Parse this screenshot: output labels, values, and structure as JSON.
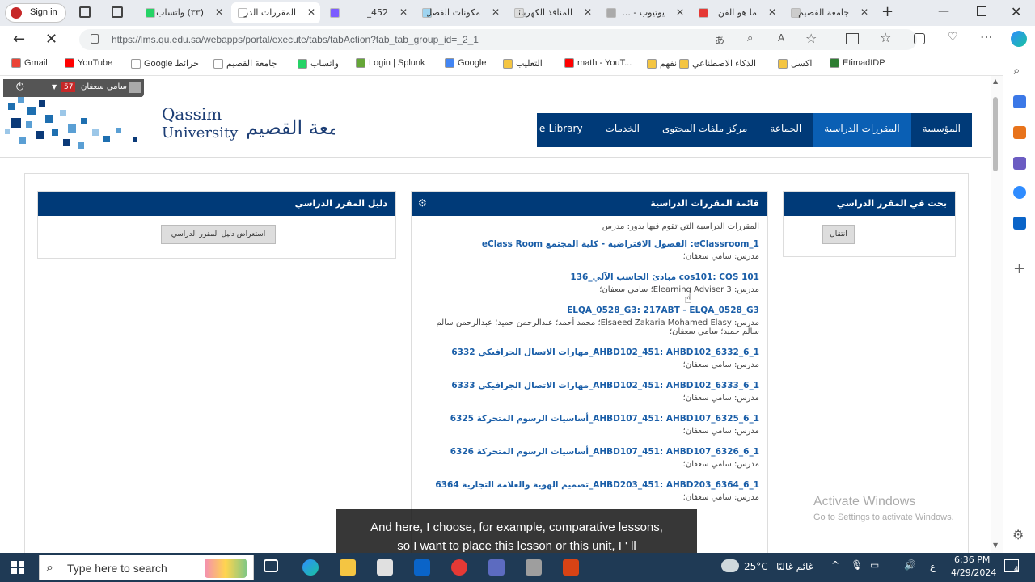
{
  "browser": {
    "profile_label": "Sign in",
    "tabs": [
      {
        "title": "(٣٣) واتساب",
        "fav_color": "#25d366"
      },
      {
        "title": "المقررات الدراسية",
        "fav_color": "#ffffff",
        "active": true
      },
      {
        "title": "452_",
        "fav_color": "#7b5cff"
      },
      {
        "title": "مكونات الفصل",
        "fav_color": "#9fd4f0"
      },
      {
        "title": "المنافذ الكهربائية",
        "fav_color": "#dddddd"
      },
      {
        "title": "يوتيوب - ...",
        "fav_color": "#aaaaaa"
      },
      {
        "title": "ما هو الفن",
        "fav_color": "#e53935"
      },
      {
        "title": "جامعة القصيم",
        "fav_color": "#cccccc"
      }
    ],
    "url": "https://lms.qu.edu.sa/webapps/portal/execute/tabs/tabAction?tab_tab_group_id=_2_1",
    "bookmarks": [
      {
        "label": "Gmail",
        "color": "#ea4335"
      },
      {
        "label": "YouTube",
        "color": "#ff0000"
      },
      {
        "label": "Google خرائط",
        "color": "#ffffff"
      },
      {
        "label": "جامعة القصيم",
        "color": "#ffffff"
      },
      {
        "label": "واتساب",
        "color": "#25d366"
      },
      {
        "label": "Login | Splunk",
        "color": "#65a637"
      },
      {
        "label": "Google",
        "color": "#4285f4"
      },
      {
        "label": "التعليب",
        "color": "#f4c542"
      },
      {
        "label": "math - YouT...",
        "color": "#ff0000"
      },
      {
        "label": "يلا نفهم",
        "color": "#f4c542"
      },
      {
        "label": "الذكاء الاصطناعي",
        "color": "#f4c542"
      },
      {
        "label": "اكسل",
        "color": "#f4c542"
      },
      {
        "label": "EtimadIDP",
        "color": "#2e7d32"
      }
    ]
  },
  "site": {
    "user_name": "سامي سعفان",
    "notification_count": "57",
    "logo_en": "Qassim University",
    "logo_ar": "جامعة القصيم",
    "nav": [
      {
        "label": "المؤسسة"
      },
      {
        "label": "المقررات الدراسية",
        "active": true
      },
      {
        "label": "الجماعة"
      },
      {
        "label": "مركز ملفات المحتوى"
      },
      {
        "label": "الخدمات"
      },
      {
        "label": "e-Library"
      }
    ]
  },
  "modules": {
    "search": {
      "title": "بحث في المقرر الدراسي",
      "button": "انتقال"
    },
    "courses": {
      "title": "قائمة المقررات الدراسية",
      "intro": "المقررات الدراسية التي تقوم فيها بدور: مدرس",
      "items": [
        {
          "title": "eClassroom_1: الفصول الافتراضية - كلية المجتمع eClass Room",
          "meta": "مدرس: سامي سعفان؛"
        },
        {
          "title": "cos101: COS 101 مبادئ الحاسب الآلي_136",
          "meta": "مدرس: Elearning Adviser 3؛ سامي سعفان؛"
        },
        {
          "title": "ELQA_0528_G3: 217ABT - ELQA_0528_G3",
          "meta": "مدرس: Elsaeed Zakaria Mohamed Elasy؛ محمد أحمد؛ عبدالرحمن حميد؛ عبدالرحمن سالم سالم حميد؛ سامي سعفان؛"
        },
        {
          "title": "1_6_AHBD102_451: AHBD102_6332_مهارات الاتصال الجرافيكي 6332",
          "meta": "مدرس: سامي سعفان؛"
        },
        {
          "title": "1_6_AHBD102_451: AHBD102_6333_مهارات الاتصال الجرافيكي 6333",
          "meta": "مدرس: سامي سعفان؛"
        },
        {
          "title": "1_6_AHBD107_451: AHBD107_6325_أساسيات الرسوم المتحركة 6325",
          "meta": "مدرس: سامي سعفان؛"
        },
        {
          "title": "1_6_AHBD107_451: AHBD107_6326_أساسيات الرسوم المتحركة 6326",
          "meta": "مدرس: سامي سعفان؛"
        },
        {
          "title": "1_6_AHBD203_451: AHBD203_6364_تصميم الهوية والعلامة التجارية 6364",
          "meta": "مدرس: سامي سعفان؛"
        }
      ]
    },
    "guide": {
      "title": "دليل المقرر الدراسي",
      "button": "استعراض دليل المقرر الدراسي"
    }
  },
  "watermark": {
    "line1": "Activate Windows",
    "line2": "Go to Settings to activate Windows."
  },
  "subtitles": {
    "line1": "And here, I choose, for example, comparative lessons,",
    "line2": "so I want to place this lesson or this unit, I ' ll"
  },
  "taskbar": {
    "search_placeholder": "Type here to search",
    "weather": "25°C",
    "weather_label": "غائم غالبًا",
    "lang": "ع",
    "time": "6:36 PM",
    "date": "4/29/2024",
    "notif_count": "4"
  }
}
